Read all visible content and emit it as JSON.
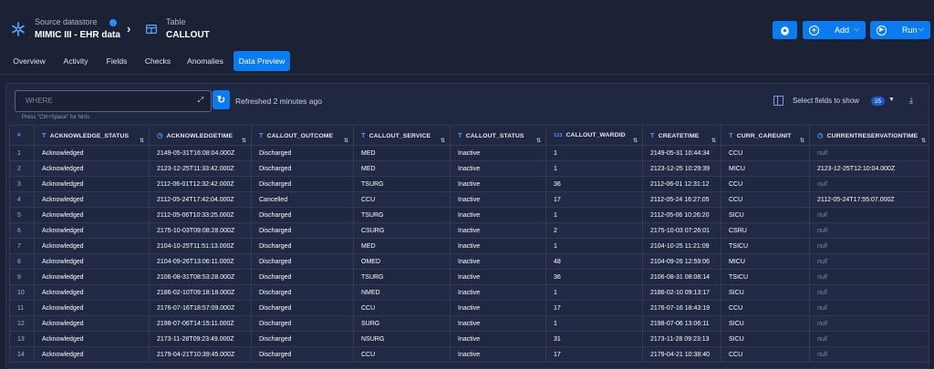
{
  "header": {
    "datastore_label": "Source datastore",
    "datastore_name": "MIMIC III - EHR data",
    "table_label": "Table",
    "table_name": "CALLOUT",
    "add_label": "Add",
    "run_label": "Run"
  },
  "tabs": [
    {
      "label": "Overview"
    },
    {
      "label": "Activity"
    },
    {
      "label": "Fields"
    },
    {
      "label": "Checks"
    },
    {
      "label": "Anomalies"
    },
    {
      "label": "Data Preview"
    }
  ],
  "active_tab": "Data Preview",
  "filter": {
    "placeholder": "WHERE",
    "hint": "Press \"Ctrl+Space\" for hints",
    "refreshed": "Refreshed 2 minutes ago"
  },
  "fields_selector": {
    "label": "Select fields to show",
    "count": "25"
  },
  "table": {
    "index_header": "#",
    "columns": [
      {
        "name": "ACKNOWLEDGE_STATUS",
        "type_icon": "T"
      },
      {
        "name": "ACKNOWLEDGETIME",
        "type_icon": "clock"
      },
      {
        "name": "CALLOUT_OUTCOME",
        "type_icon": "T"
      },
      {
        "name": "CALLOUT_SERVICE",
        "type_icon": "T"
      },
      {
        "name": "CALLOUT_STATUS",
        "type_icon": "T"
      },
      {
        "name": "CALLOUT_WARDID",
        "type_icon": "123"
      },
      {
        "name": "CREATETIME",
        "type_icon": "T"
      },
      {
        "name": "CURR_CAREUNIT",
        "type_icon": "T"
      },
      {
        "name": "CURRENTRESERVATIONTIME",
        "type_icon": "clock"
      }
    ],
    "rows": [
      [
        "1",
        "Acknowledged",
        "2149-05-31T16:08:04.000Z",
        "Discharged",
        "MED",
        "Inactive",
        "1",
        "2149-05-31 10:44:34",
        "CCU",
        "null"
      ],
      [
        "2",
        "Acknowledged",
        "2123-12-25T11:33:42.000Z",
        "Discharged",
        "MED",
        "Inactive",
        "1",
        "2123-12-25 10:29:39",
        "MICU",
        "2123-12-25T12:10:04.000Z"
      ],
      [
        "3",
        "Acknowledged",
        "2112-06-01T12:32:42.000Z",
        "Discharged",
        "TSURG",
        "Inactive",
        "36",
        "2112-06-01 12:31:12",
        "CCU",
        "null"
      ],
      [
        "4",
        "Acknowledged",
        "2112-05-24T17:42:04.000Z",
        "Cancelled",
        "CCU",
        "Inactive",
        "17",
        "2112-05-24 16:27:05",
        "CCU",
        "2112-05-24T17:55:07.000Z"
      ],
      [
        "5",
        "Acknowledged",
        "2112-05-06T10:33:25.000Z",
        "Discharged",
        "TSURG",
        "Inactive",
        "1",
        "2112-05-06 10:26:20",
        "SICU",
        "null"
      ],
      [
        "6",
        "Acknowledged",
        "2175-10-03T09:08:28.000Z",
        "Discharged",
        "CSURG",
        "Inactive",
        "2",
        "2175-10-03 07:26:01",
        "CSRU",
        "null"
      ],
      [
        "7",
        "Acknowledged",
        "2104-10-25T11:51:13.000Z",
        "Discharged",
        "MED",
        "Inactive",
        "1",
        "2104-10-25 11:21:09",
        "TSICU",
        "null"
      ],
      [
        "8",
        "Acknowledged",
        "2104-09-26T13:06:11.000Z",
        "Discharged",
        "OMED",
        "Inactive",
        "48",
        "2104-09-26 12:59:06",
        "MICU",
        "null"
      ],
      [
        "9",
        "Acknowledged",
        "2106-08-31T08:53:28.000Z",
        "Discharged",
        "TSURG",
        "Inactive",
        "36",
        "2106-08-31 08:08:14",
        "TSICU",
        "null"
      ],
      [
        "10",
        "Acknowledged",
        "2186-02-10T09:18:18.000Z",
        "Discharged",
        "NMED",
        "Inactive",
        "1",
        "2186-02-10 09:13:17",
        "SICU",
        "null"
      ],
      [
        "11",
        "Acknowledged",
        "2176-07-16T18:57:09.000Z",
        "Discharged",
        "CCU",
        "Inactive",
        "17",
        "2176-07-16 18:43:19",
        "CCU",
        "null"
      ],
      [
        "12",
        "Acknowledged",
        "2198-07-06T14:15:11.000Z",
        "Discharged",
        "SURG",
        "Inactive",
        "1",
        "2198-07-06 13:06:11",
        "SICU",
        "null"
      ],
      [
        "13",
        "Acknowledged",
        "2173-11-28T09:23:49.000Z",
        "Discharged",
        "NSURG",
        "Inactive",
        "31",
        "2173-11-28 09:23:13",
        "SICU",
        "null"
      ],
      [
        "14",
        "Acknowledged",
        "2179-04-21T10:39:45.000Z",
        "Discharged",
        "CCU",
        "Inactive",
        "17",
        "2179-04-21 10:38:40",
        "CCU",
        "null"
      ]
    ]
  }
}
